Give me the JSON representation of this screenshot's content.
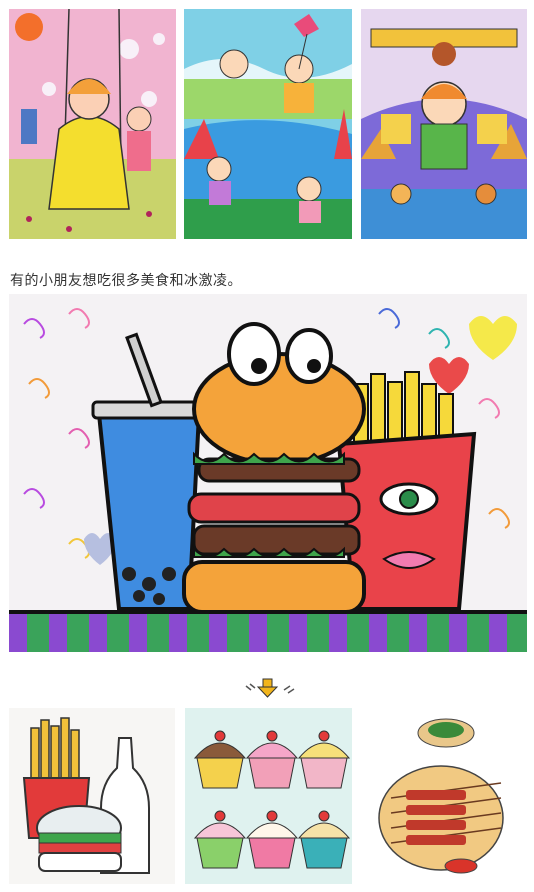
{
  "caption": "有的小朋友想吃很多美食和冰激凌。",
  "colors": {
    "text": "#333333",
    "arrow": "#f2b51c",
    "tick": "#555555"
  },
  "icons": {
    "divider_arrow": "arrow-down-icon"
  }
}
